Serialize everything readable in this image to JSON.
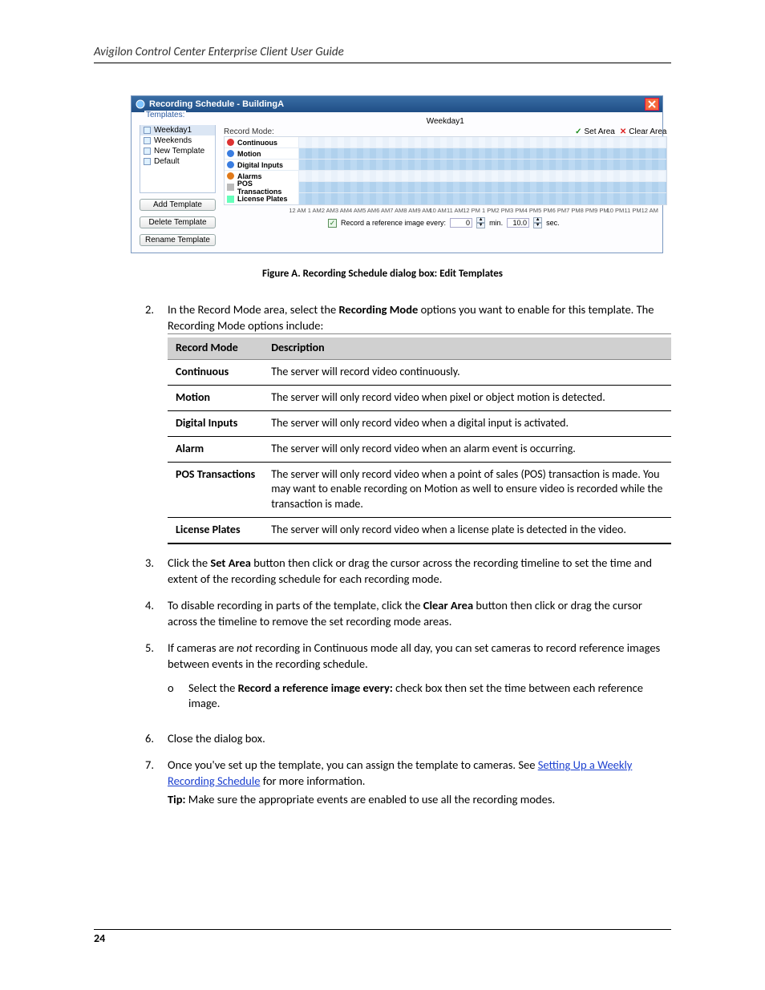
{
  "header": {
    "doc_title": "Avigilon Control Center Enterprise Client User Guide"
  },
  "dialog": {
    "title": "Recording Schedule - BuildingA",
    "group_label": "Templates:",
    "templates": [
      {
        "label": "Weekday1",
        "selected": true
      },
      {
        "label": "Weekends",
        "selected": false
      },
      {
        "label": "New Template",
        "selected": false
      },
      {
        "label": "Default",
        "selected": false
      }
    ],
    "buttons": {
      "add": "Add Template",
      "delete": "Delete Template",
      "rename": "Rename Template"
    },
    "current_template": "Weekday1",
    "record_mode_label": "Record Mode:",
    "set_area": "Set Area",
    "clear_area": "Clear Area",
    "modes": [
      {
        "label": "Continuous",
        "icon": "red",
        "filled": false
      },
      {
        "label": "Motion",
        "icon": "blue",
        "filled": true
      },
      {
        "label": "Digital Inputs",
        "icon": "blue",
        "filled": true
      },
      {
        "label": "Alarms",
        "icon": "orange",
        "filled": false
      },
      {
        "label": "POS Transactions",
        "icon": "gray",
        "filled": true
      },
      {
        "label": "License Plates",
        "icon": "teal",
        "filled": true
      }
    ],
    "hours": [
      "12 AM",
      "1 AM",
      "2 AM",
      "3 AM",
      "4 AM",
      "5 AM",
      "6 AM",
      "7 AM",
      "8 AM",
      "9 AM",
      "10 AM",
      "11 AM",
      "12 PM",
      "1 PM",
      "2 PM",
      "3 PM",
      "4 PM",
      "5 PM",
      "6 PM",
      "7 PM",
      "8 PM",
      "9 PM",
      "10 PM",
      "11 PM",
      "12 AM"
    ],
    "ref": {
      "label": "Record a reference image every:",
      "min_value": "0",
      "min_unit": "min.",
      "sec_value": "10.0",
      "sec_unit": "sec."
    }
  },
  "figure_caption": "Figure A.   Recording Schedule dialog box: Edit Templates",
  "steps": {
    "s2": {
      "num": "2.",
      "text": "In the Record Mode area, select the ",
      "text2": " options you want to enable for this template. The Recording Mode options include:",
      "bold": "Recording Mode",
      "table": {
        "h1": "Record Mode",
        "h2": "Description",
        "rows": [
          {
            "m": "Continuous",
            "d": "The server will record video continuously."
          },
          {
            "m": "Motion",
            "d": "The server will only record video when pixel or object motion is detected."
          },
          {
            "m": "Digital Inputs",
            "d": "The server will only record video when a digital input is activated."
          },
          {
            "m": "Alarm",
            "d": "The server will only record video when an alarm event is occurring."
          },
          {
            "m": "POS Transactions",
            "d": "The server will only record video when a point of sales (POS) transaction is made. You may want to enable recording on Motion as well to ensure video is recorded while the transaction is made."
          },
          {
            "m": "License Plates",
            "d": "The server will only record video when a license plate is detected in the video."
          }
        ]
      }
    },
    "s3": {
      "num": "3.",
      "text": "Click the ",
      "bold": "Set Area",
      "text2": " button then click or drag the cursor across the recording timeline to set the time and extent of the recording schedule for each recording mode."
    },
    "s4": {
      "num": "4.",
      "text_a": "To disable recording in parts of the template, click the ",
      "bold_a": "Clear Area",
      "text_b": " button then click or drag the cursor across the timeline to remove the set recording mode areas."
    },
    "s5": {
      "num": "5.",
      "text": "If cameras are ",
      "italic": "not",
      "text2": " recording in Continuous mode all day, you can set cameras to record reference images between events in the recording schedule.",
      "sub": {
        "subnum": "o",
        "subtext_a": "Select the ",
        "subbold": "Record a reference image every:",
        "subtext_b": " check box then set the time between each reference image."
      }
    },
    "s6": {
      "num": "6.",
      "text": "Close the dialog box."
    },
    "s7": {
      "num": "7.",
      "text_a": "Once you've set up the template, you can assign the template to cameras. See ",
      "link": "Setting Up a Weekly Recording Schedule",
      "text_b": " for more information.",
      "tip_label": "Tip:",
      "tip_text": " Make sure the appropriate events are enabled to use all the recording modes."
    }
  },
  "footer": {
    "page": "24"
  }
}
